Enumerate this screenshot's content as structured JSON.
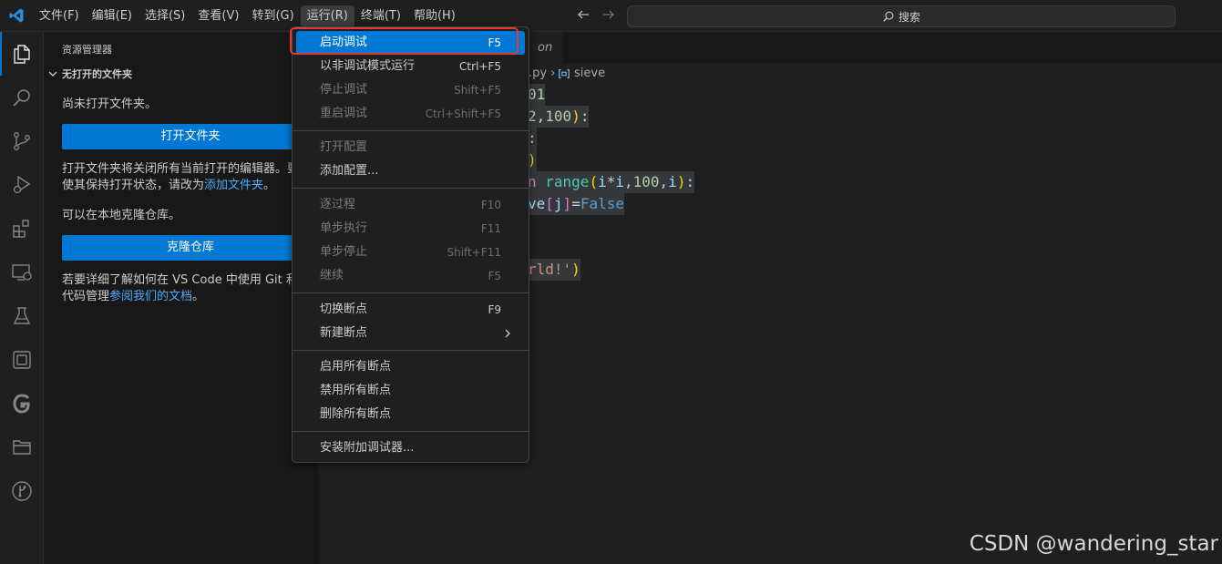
{
  "menubar": {
    "items": [
      "文件(F)",
      "编辑(E)",
      "选择(S)",
      "查看(V)",
      "转到(G)",
      "运行(R)",
      "终端(T)",
      "帮助(H)"
    ],
    "active_index": 5
  },
  "search": {
    "label": "搜索"
  },
  "sidebar": {
    "title": "资源管理器",
    "section": "无打开的文件夹",
    "no_folder_text": "尚未打开文件夹。",
    "open_folder_button": "打开文件夹",
    "open_folder_desc_line1": "打开文件夹将关闭所有当前打开的编辑器。要",
    "open_folder_desc_line2_prefix": "使其保持打开状态，请改为",
    "add_folder_link": "添加文件夹",
    "open_folder_desc_line2_suffix": "。",
    "clone_text": "可以在本地克隆仓库。",
    "clone_button": "克隆仓库",
    "git_desc_line1": "若要详细了解如何在 VS Code 中使用 Git 和源",
    "git_desc_line2_prefix": "代码管理",
    "docs_link": "参阅我们的文档",
    "git_desc_line2_suffix": "。"
  },
  "editor": {
    "tab_label": "on",
    "breadcrumb_file": ".py",
    "breadcrumb_symbol": "sieve",
    "code_fragments": [
      "01",
      "2,100):",
      ":",
      ")",
      "n range(i*i,100,i):",
      "ve[j]=False",
      "",
      "",
      "rld!')"
    ]
  },
  "run_menu": {
    "groups": [
      [
        {
          "label": "启动调试",
          "key": "F5",
          "disabled": false,
          "selected": true
        },
        {
          "label": "以非调试模式运行",
          "key": "Ctrl+F5",
          "disabled": false
        },
        {
          "label": "停止调试",
          "key": "Shift+F5",
          "disabled": true
        },
        {
          "label": "重启调试",
          "key": "Ctrl+Shift+F5",
          "disabled": true
        }
      ],
      [
        {
          "label": "打开配置",
          "key": "",
          "disabled": true
        },
        {
          "label": "添加配置...",
          "key": "",
          "disabled": false
        }
      ],
      [
        {
          "label": "逐过程",
          "key": "F10",
          "disabled": true
        },
        {
          "label": "单步执行",
          "key": "F11",
          "disabled": true
        },
        {
          "label": "单步停止",
          "key": "Shift+F11",
          "disabled": true
        },
        {
          "label": "继续",
          "key": "F5",
          "disabled": true
        }
      ],
      [
        {
          "label": "切换断点",
          "key": "F9",
          "disabled": false
        },
        {
          "label": "新建断点",
          "key": "",
          "disabled": false,
          "submenu": true
        }
      ],
      [
        {
          "label": "启用所有断点",
          "key": "",
          "disabled": false
        },
        {
          "label": "禁用所有断点",
          "key": "",
          "disabled": false
        },
        {
          "label": "删除所有断点",
          "key": "",
          "disabled": false
        }
      ],
      [
        {
          "label": "安装附加调试器...",
          "key": "",
          "disabled": false
        }
      ]
    ]
  },
  "activity_icons": [
    "explorer-icon",
    "search-icon",
    "source-control-icon",
    "run-debug-icon",
    "extensions-icon",
    "remote-explorer-icon",
    "testing-icon",
    "layout-icon",
    "gitlens-icon",
    "folders-icon",
    "git-graph-icon"
  ],
  "watermark": "CSDN @wandering_star",
  "colors": {
    "accent": "#0078d4",
    "highlight_border": "#e53935",
    "link": "#4daafc"
  }
}
